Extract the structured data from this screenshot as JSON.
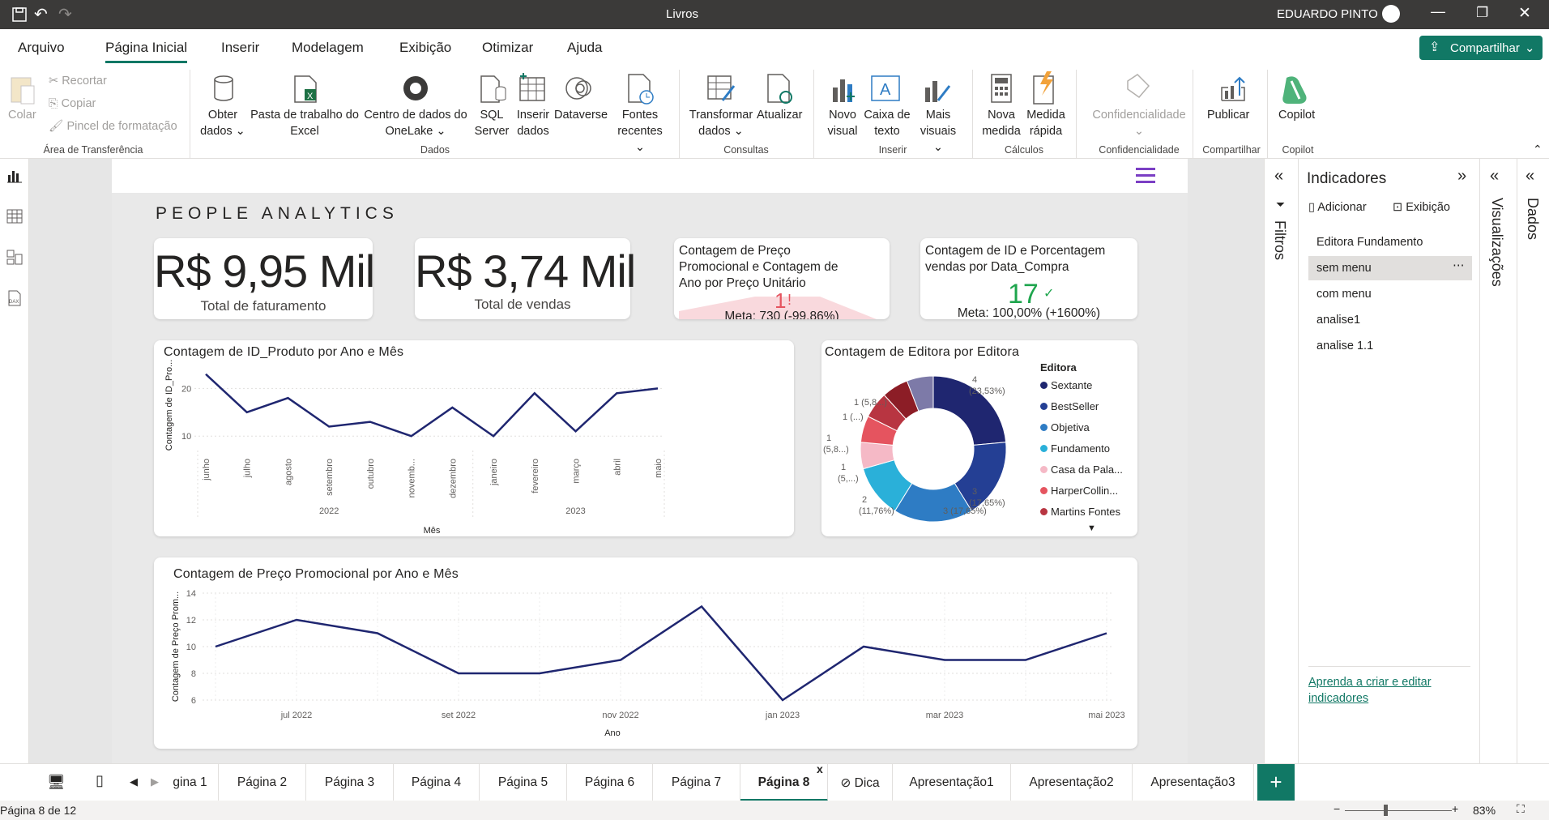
{
  "window": {
    "title": "Livros",
    "user": "EDUARDO PINTO"
  },
  "menu": {
    "items": [
      "Arquivo",
      "Página Inicial",
      "Inserir",
      "Modelagem",
      "Exibição",
      "Otimizar",
      "Ajuda"
    ],
    "share": "Compartilhar"
  },
  "ribbon": {
    "clipboard": {
      "paste": "Colar",
      "cut": "Recortar",
      "copy": "Copiar",
      "format": "Pincel de formatação",
      "group": "Área de Transferência"
    },
    "data": {
      "get_data_1": "Obter",
      "get_data_2": "dados",
      "excel_1": "Pasta de trabalho do",
      "excel_2": "Excel",
      "onelake_1": "Centro de dados do",
      "onelake_2": "OneLake",
      "sql_1": "SQL",
      "sql_2": "Server",
      "insert_1": "Inserir",
      "insert_2": "dados",
      "dataverse": "Dataverse",
      "recent_1": "Fontes",
      "recent_2": "recentes",
      "group": "Dados"
    },
    "queries": {
      "transform_1": "Transformar",
      "transform_2": "dados",
      "refresh": "Atualizar",
      "group": "Consultas"
    },
    "insert": {
      "visual_1": "Novo",
      "visual_2": "visual",
      "text_1": "Caixa de",
      "text_2": "texto",
      "more_1": "Mais",
      "more_2": "visuais",
      "group": "Inserir"
    },
    "calc": {
      "measure_1": "Nova",
      "measure_2": "medida",
      "quick_1": "Medida",
      "quick_2": "rápida",
      "group": "Cálculos"
    },
    "conf": {
      "label": "Confidencialidade",
      "group": "Confidencialidade"
    },
    "share": {
      "publish": "Publicar",
      "group": "Compartilhar"
    },
    "copilot": {
      "label": "Copilot",
      "group": "Copilot"
    }
  },
  "report": {
    "title": "PEOPLE ANALYTICS",
    "kpi1": {
      "value": "R$ 9,95 Mil",
      "label": "Total de faturamento"
    },
    "kpi2": {
      "value": "R$ 3,74 Mil",
      "label": "Total de vendas"
    },
    "kpi3": {
      "title": "Contagem de Preço Promocional e Contagem de Ano por Preço Unitário",
      "value": "1",
      "alert": "!",
      "goal": "Meta: 730 (-99.86%)"
    },
    "kpi4": {
      "title": "Contagem de ID e Porcentagem vendas por Data_Compra",
      "value": "17",
      "goal": "Meta: 100,00% (+1600%)"
    }
  },
  "chart_data": [
    {
      "type": "line",
      "title": "Contagem de ID_Produto por Ano e Mês",
      "xlabel": "Mês",
      "ylabel": "Contagem de ID_Pro...",
      "groups": [
        "2022",
        "2023"
      ],
      "categories": [
        "junho",
        "julho",
        "agosto",
        "setembro",
        "outubro",
        "novemb...",
        "dezembro",
        "janeiro",
        "fevereiro",
        "março",
        "abril",
        "maio"
      ],
      "values": [
        23,
        15,
        18,
        12,
        13,
        10,
        16,
        10,
        19,
        11,
        19,
        20
      ],
      "yticks": [
        10,
        20
      ],
      "ylim": [
        8,
        25
      ]
    },
    {
      "type": "pie",
      "title": "Contagem de Editora por Editora",
      "legend_title": "Editora",
      "legend": [
        "Sextante",
        "BestSeller",
        "Objetiva",
        "Fundamento",
        "Casa da Pala...",
        "HarperCollin...",
        "Martins Fontes"
      ],
      "slices": [
        {
          "value": 4,
          "label": "4",
          "pct": "(23,53%)",
          "color": "#1f2670"
        },
        {
          "value": 3,
          "label": "3",
          "pct": "(17,65%)",
          "color": "#243f94"
        },
        {
          "value": 3,
          "label": "3 (17,65%)",
          "pct": "",
          "color": "#2e7cc4"
        },
        {
          "value": 2,
          "label": "2",
          "pct": "(11,76%)",
          "color": "#2ab0d9"
        },
        {
          "value": 1,
          "label": "1",
          "pct": "(5,...)",
          "color": "#f5b9c6"
        },
        {
          "value": 1,
          "label": "1",
          "pct": "(5,8...)",
          "color": "#e5545f"
        },
        {
          "value": 1,
          "label": "1 (...)",
          "pct": "",
          "color": "#b83541"
        },
        {
          "value": 1,
          "label": "1 (5,8...)",
          "pct": "",
          "color": "#8c1d26"
        },
        {
          "value": 1,
          "label": "",
          "pct": "",
          "color": "#7d7aa8"
        }
      ],
      "legend_colors": [
        "#1f2670",
        "#243f94",
        "#2e7cc4",
        "#2ab0d9",
        "#f5b9c6",
        "#e5545f",
        "#b83541"
      ]
    },
    {
      "type": "line",
      "title": "Contagem de Preço Promocional por Ano e Mês",
      "xlabel": "Ano",
      "ylabel": "Contagem de Preço Prom...",
      "x": [
        "2022-06",
        "2022-07",
        "2022-08",
        "2022-09",
        "2022-10",
        "2022-11",
        "2022-12",
        "2023-01",
        "2023-02",
        "2023-03",
        "2023-04",
        "2023-05"
      ],
      "xticks": [
        "jul 2022",
        "set 2022",
        "nov 2022",
        "jan 2023",
        "mar 2023",
        "mai 2023"
      ],
      "values": [
        10,
        12,
        11,
        8,
        8,
        9,
        13,
        6,
        10,
        9,
        9,
        11
      ],
      "yticks": [
        6,
        8,
        10,
        12,
        14
      ],
      "ylim": [
        6,
        14
      ]
    }
  ],
  "panes": {
    "filters": "Filtros",
    "bookmarks": {
      "title": "Indicadores",
      "add": "Adicionar",
      "view": "Exibição",
      "items": [
        "Editora Fundamento",
        "sem menu",
        "com menu",
        "analise1",
        "analise 1.1"
      ],
      "link": "Aprenda a criar e editar indicadores"
    },
    "vis": "Visualizações",
    "data": "Dados"
  },
  "tabs": [
    "gina 1",
    "Página 2",
    "Página 3",
    "Página 4",
    "Página 5",
    "Página 6",
    "Página 7",
    "Página 8",
    "Dica",
    "Apresentação1",
    "Apresentação2",
    "Apresentação3"
  ],
  "status": {
    "page": "Página 8 de 12",
    "zoom": "83%"
  }
}
